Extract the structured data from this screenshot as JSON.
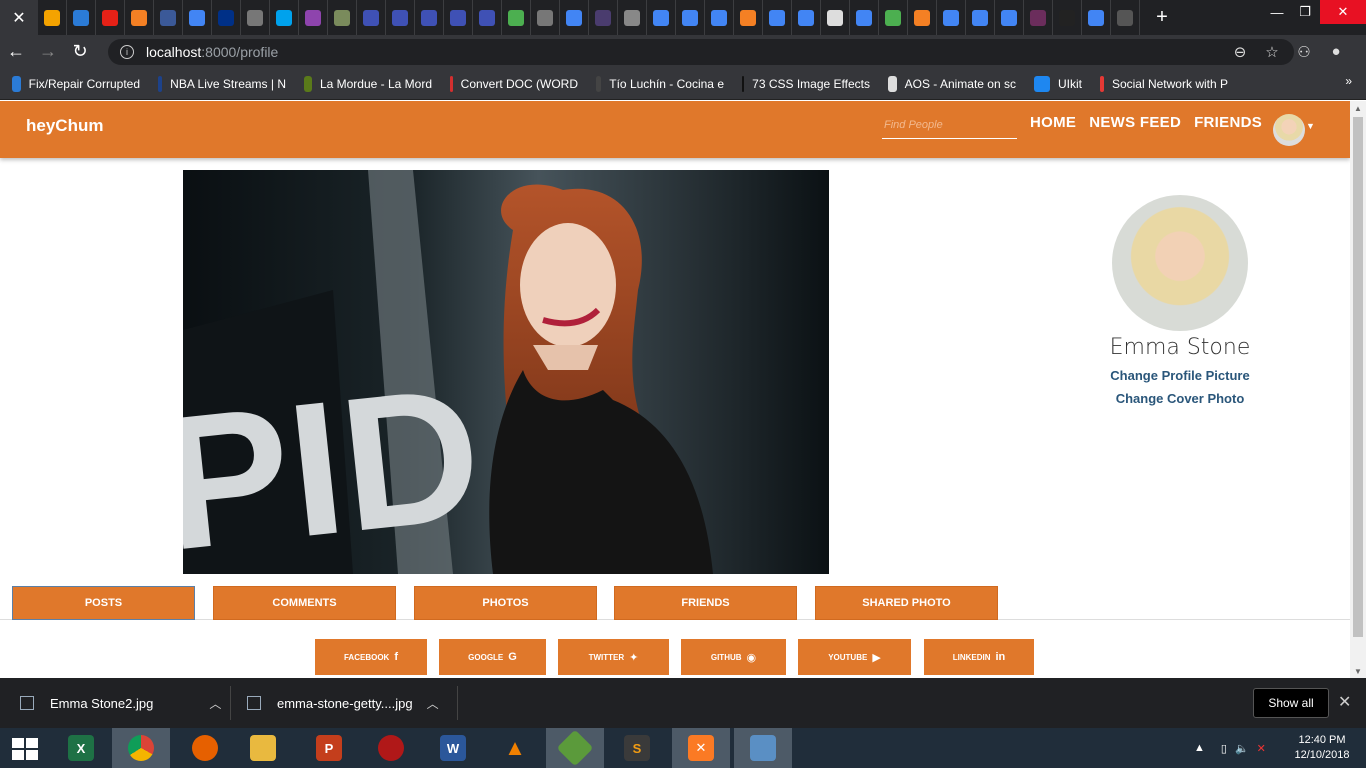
{
  "browser": {
    "url_host": "localhost",
    "url_rest": ":8000/profile",
    "bookmarks": [
      {
        "label": "Fix/Repair Corrupted",
        "color": "#2b7bd6"
      },
      {
        "label": "NBA Live Streams | N",
        "color": "#1d428a"
      },
      {
        "label": "La Mordue - La Mord",
        "color": "#5a7a1a"
      },
      {
        "label": "Convert DOC (WORD",
        "color": "#d32f2f"
      },
      {
        "label": "Tío Luchín - Cocina e",
        "color": "#444"
      },
      {
        "label": "73 CSS Image Effects",
        "color": "#111"
      },
      {
        "label": "AOS - Animate on sc",
        "color": "#ddd"
      },
      {
        "label": "UIkit",
        "color": "#1e87f0"
      },
      {
        "label": "Social Network with P",
        "color": "#e53935"
      }
    ]
  },
  "app": {
    "brand": "heyChum",
    "search_placeholder": "Find People",
    "nav": [
      "HOME",
      "NEWS FEED",
      "FRIENDS"
    ]
  },
  "profile": {
    "name": "Emma Stone",
    "change_picture": "Change Profile Picture",
    "change_cover": "Change Cover Photo",
    "cover_text": "PID"
  },
  "tabs": [
    "POSTS",
    "COMMENTS",
    "PHOTOS",
    "FRIENDS",
    "SHARED PHOTO"
  ],
  "social": [
    {
      "label": "FACEBOOK",
      "icon": "f"
    },
    {
      "label": "GOOGLE",
      "icon": "G"
    },
    {
      "label": "TWITTER",
      "icon": "✦"
    },
    {
      "label": "GITHUB",
      "icon": "◉"
    },
    {
      "label": "YOUTUBE",
      "icon": "▶"
    },
    {
      "label": "LINKEDIN",
      "icon": "in"
    }
  ],
  "downloads": [
    "Emma Stone2.jpg",
    "emma-stone-getty....jpg"
  ],
  "download_show_all": "Show all",
  "clock": {
    "time": "12:40 PM",
    "date": "12/10/2018"
  }
}
